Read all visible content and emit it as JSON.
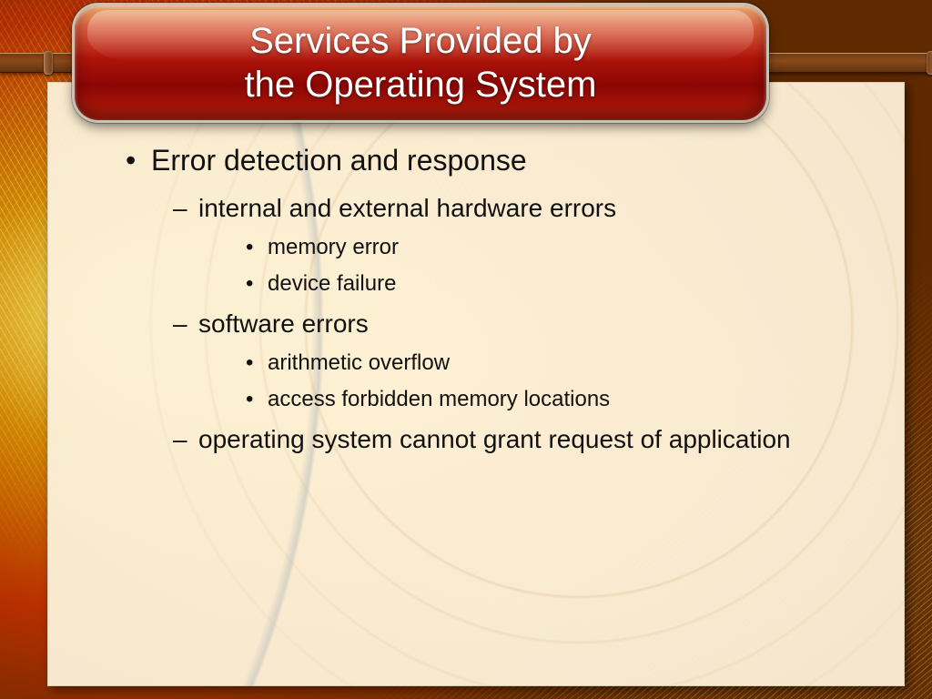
{
  "title": {
    "line1": "Services Provided by",
    "line2": "the Operating System"
  },
  "body": {
    "topic": "Error detection and response",
    "points": [
      {
        "text": "internal and external hardware errors",
        "sub": [
          "memory error",
          "device failure"
        ]
      },
      {
        "text": "software errors",
        "sub": [
          "arithmetic overflow",
          "access forbidden memory locations"
        ]
      },
      {
        "text": "operating system cannot grant request of application",
        "sub": []
      }
    ]
  }
}
